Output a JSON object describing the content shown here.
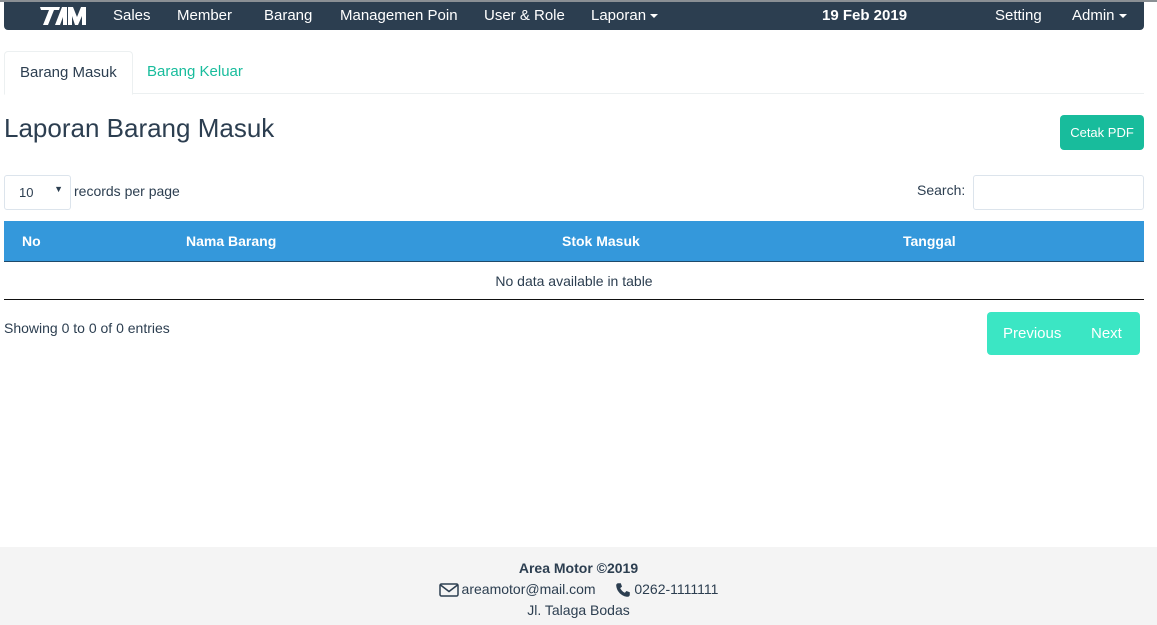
{
  "navbar": {
    "brand": "AM",
    "items": [
      {
        "label": "Sales"
      },
      {
        "label": "Member"
      },
      {
        "label": "Barang"
      },
      {
        "label": "Managemen Poin"
      },
      {
        "label": "User & Role"
      },
      {
        "label": "Laporan"
      }
    ],
    "date": "19 Feb 2019",
    "setting": "Setting",
    "user": "Admin"
  },
  "tabs": [
    {
      "label": "Barang Masuk",
      "active": true
    },
    {
      "label": "Barang Keluar",
      "active": false
    }
  ],
  "page": {
    "title": "Laporan Barang Masuk",
    "print_button": "Cetak PDF"
  },
  "table_controls": {
    "page_length": "10",
    "page_length_suffix": "records per page",
    "search_label": "Search:",
    "search_value": ""
  },
  "table": {
    "columns": [
      "No",
      "Nama Barang",
      "Stok Masuk",
      "Tanggal"
    ],
    "empty_message": "No data available in table",
    "info": "Showing 0 to 0 of 0 entries",
    "previous": "Previous",
    "next": "Next"
  },
  "footer": {
    "title": "Area Motor ©2019",
    "email": "areamotor@mail.com",
    "phone": "0262-1111111",
    "address": "Jl. Talaga Bodas"
  },
  "colors": {
    "navbar": "#2c3e50",
    "accent": "#18bc9c",
    "table_header": "#3498db",
    "pager": "#3be6c4",
    "footer_bg": "#f4f4f4"
  }
}
